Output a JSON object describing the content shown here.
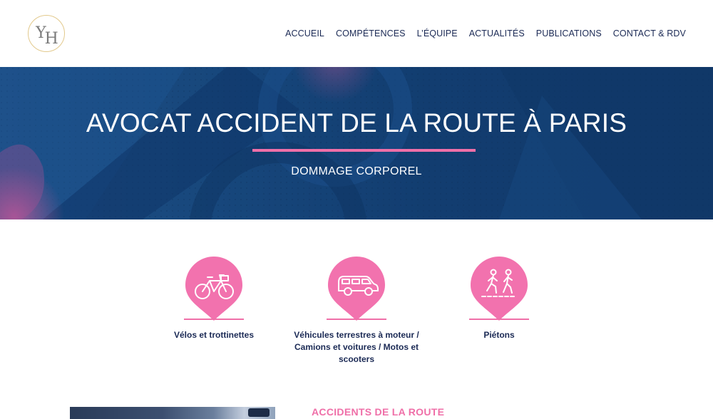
{
  "header": {
    "logo_text_top": "Y",
    "logo_text_bottom": "H",
    "nav": [
      {
        "label": "ACCUEIL"
      },
      {
        "label": "COMPÉTENCES"
      },
      {
        "label": "L’ÉQUIPE"
      },
      {
        "label": "ACTUALITÉS"
      },
      {
        "label": "PUBLICATIONS"
      },
      {
        "label": "CONTACT & RDV"
      }
    ]
  },
  "hero": {
    "title": "AVOCAT ACCIDENT DE LA ROUTE À PARIS",
    "subtitle": "DOMMAGE CORPOREL"
  },
  "categories": [
    {
      "icon": "bicycle-icon",
      "label": "Vélos et trottinettes"
    },
    {
      "icon": "car-icon",
      "label": "Véhicules terrestres à moteur / Camions et voitures / Motos et scooters"
    },
    {
      "icon": "pedestrian-icon",
      "label": "Piétons"
    }
  ],
  "section": {
    "title": "ACCIDENTS DE LA ROUTE"
  },
  "colors": {
    "accent_pink": "#ef6fa8",
    "navy": "#14264a",
    "hero_blue": "#17477c",
    "logo_gold": "#e2c98c"
  }
}
